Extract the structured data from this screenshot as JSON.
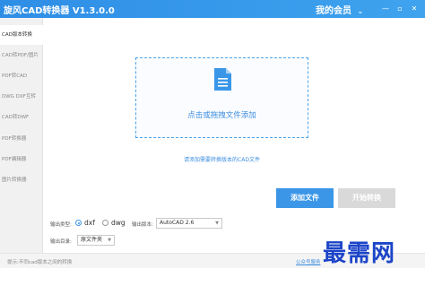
{
  "window": {
    "title": "旋风CAD转换器 V1.3.0.0",
    "member_label": "我的会员",
    "member_caret": "⌄",
    "minimize_glyph": "—",
    "restore_glyph": "▫",
    "close_glyph": "✕"
  },
  "sidebar": {
    "items": [
      {
        "label": "CAD版本转换"
      },
      {
        "label": "CAD转PDF/图片"
      },
      {
        "label": "PDF转CAD"
      },
      {
        "label": "DWG DXF互转"
      },
      {
        "label": "CAD转DWF"
      },
      {
        "label": "PDF转换器"
      },
      {
        "label": "PDF编辑器"
      },
      {
        "label": "图片转换器"
      }
    ]
  },
  "dropzone": {
    "text": "点击或拖拽文件添加",
    "icon": "document-icon"
  },
  "add_hint": "请添加需要转换版本的CAD文件",
  "buttons": {
    "add_file": "添加文件",
    "start": "开始转换"
  },
  "options": {
    "output_type_label": "输出类型:",
    "type_dxf": "dxf",
    "type_dwg": "dwg",
    "selected_type": "dxf",
    "version_label": "输出版本:",
    "version_value": "AutoCAD 2.6",
    "dir_label": "输出目录:",
    "dir_value": "原文件夹"
  },
  "status": {
    "text": "提示:不同cad版本之间的转换",
    "link": "公众号服务"
  },
  "watermark": "最需网",
  "colors": {
    "title_bar": "#3fa3ee",
    "accent": "#3b96e8",
    "disabled": "#d9d9d9",
    "watermark": "#1b44c8"
  }
}
